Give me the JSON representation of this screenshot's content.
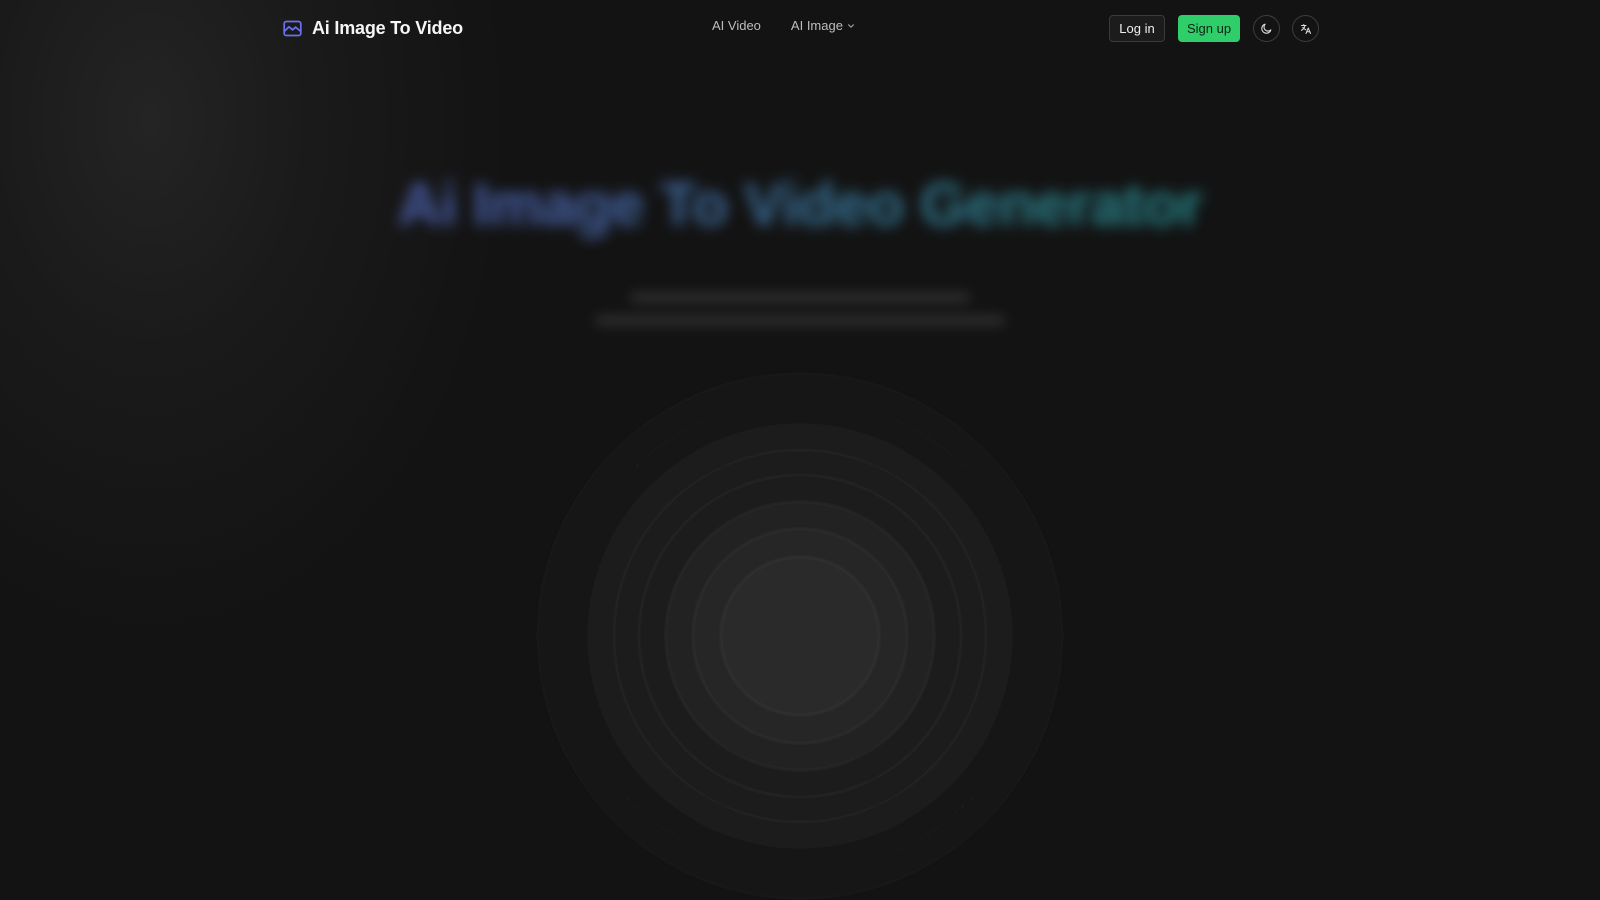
{
  "brand": {
    "name": "Ai Image To Video",
    "icon": "image-icon",
    "accent": "#6a6ff0"
  },
  "nav": {
    "items": [
      {
        "label": "AI Video"
      },
      {
        "label": "AI Image",
        "has_dropdown": true
      }
    ]
  },
  "auth": {
    "login_label": "Log in",
    "signup_label": "Sign up",
    "signup_color": "#2fce6a"
  },
  "toolbar": {
    "theme_icon": "moon-icon",
    "language_icon": "translate-icon"
  },
  "hero": {
    "title": "Ai Image To Video Generator"
  }
}
